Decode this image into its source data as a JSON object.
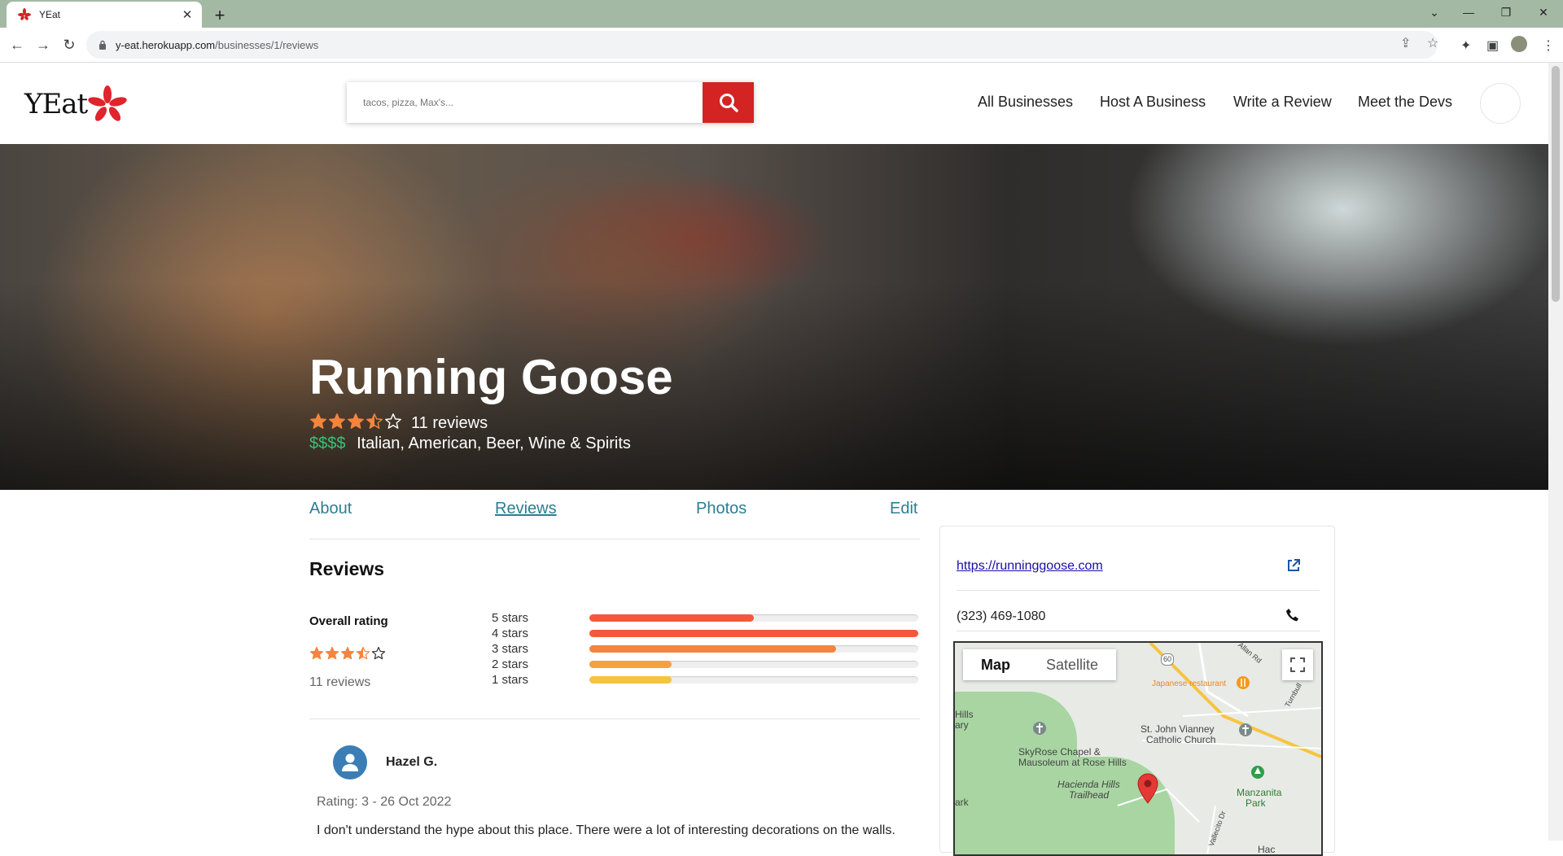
{
  "browser": {
    "tab_title": "YEat",
    "url_host": "y-eat.herokuapp.com",
    "url_path": "/businesses/1/reviews"
  },
  "header": {
    "logo_text": "YEat",
    "search_placeholder": "tacos, pizza, Max's...",
    "nav": [
      "All Businesses",
      "Host A Business",
      "Write a Review",
      "Meet the Devs"
    ]
  },
  "business": {
    "name": "Running Goose",
    "rating": 3.5,
    "review_count_label": "11 reviews",
    "price": "$$$$",
    "categories": "Italian, American, Beer, Wine & Spirits"
  },
  "tabs": [
    "About",
    "Reviews",
    "Photos",
    "Edit"
  ],
  "reviews_section": {
    "title": "Reviews",
    "overall_label": "Overall rating",
    "overall_rating": 3.5,
    "overall_count": "11 reviews",
    "bars": [
      {
        "label": "5 stars",
        "fraction": 0.5,
        "color": "#f2593a"
      },
      {
        "label": "4 stars",
        "fraction": 1.0,
        "color": "#f2593a"
      },
      {
        "label": "3 stars",
        "fraction": 0.75,
        "color": "#f5843d"
      },
      {
        "label": "2 stars",
        "fraction": 0.25,
        "color": "#f7a03f"
      },
      {
        "label": "1 stars",
        "fraction": 0.25,
        "color": "#f5c242"
      }
    ]
  },
  "review": {
    "name": "Hazel G.",
    "meta": "Rating: 3 - 26 Oct 2022",
    "text": "I don't understand the hype about this place. There were a lot of interesting decorations on the walls."
  },
  "sidebar": {
    "website": "https://runninggoose.com",
    "phone": "(323) 469-1080",
    "map_tab_map": "Map",
    "map_tab_satellite": "Satellite",
    "map_labels": {
      "japanese": "Japanese restaurant",
      "church_1": "St. John Vianney",
      "church_2": "Catholic Church",
      "chapel_1": "SkyRose Chapel &",
      "chapel_2": "Mausoleum at Rose Hills",
      "hacienda_1": "Hacienda Hills",
      "hacienda_2": "Trailhead",
      "manzanita_1": "Manzanita",
      "manzanita_2": "Park",
      "hills": "Hills",
      "ary": "ary",
      "ark": "ark",
      "route": "60",
      "road": "Allan Rd",
      "turnbull": "Turnbull",
      "vallecito": "Vallecito Dr",
      "hac": "Hac"
    }
  },
  "colors": {
    "brand_red": "#d32323",
    "link_teal": "#2a7f92",
    "price_green": "#36c27a",
    "star_orange": "#f5843d"
  }
}
